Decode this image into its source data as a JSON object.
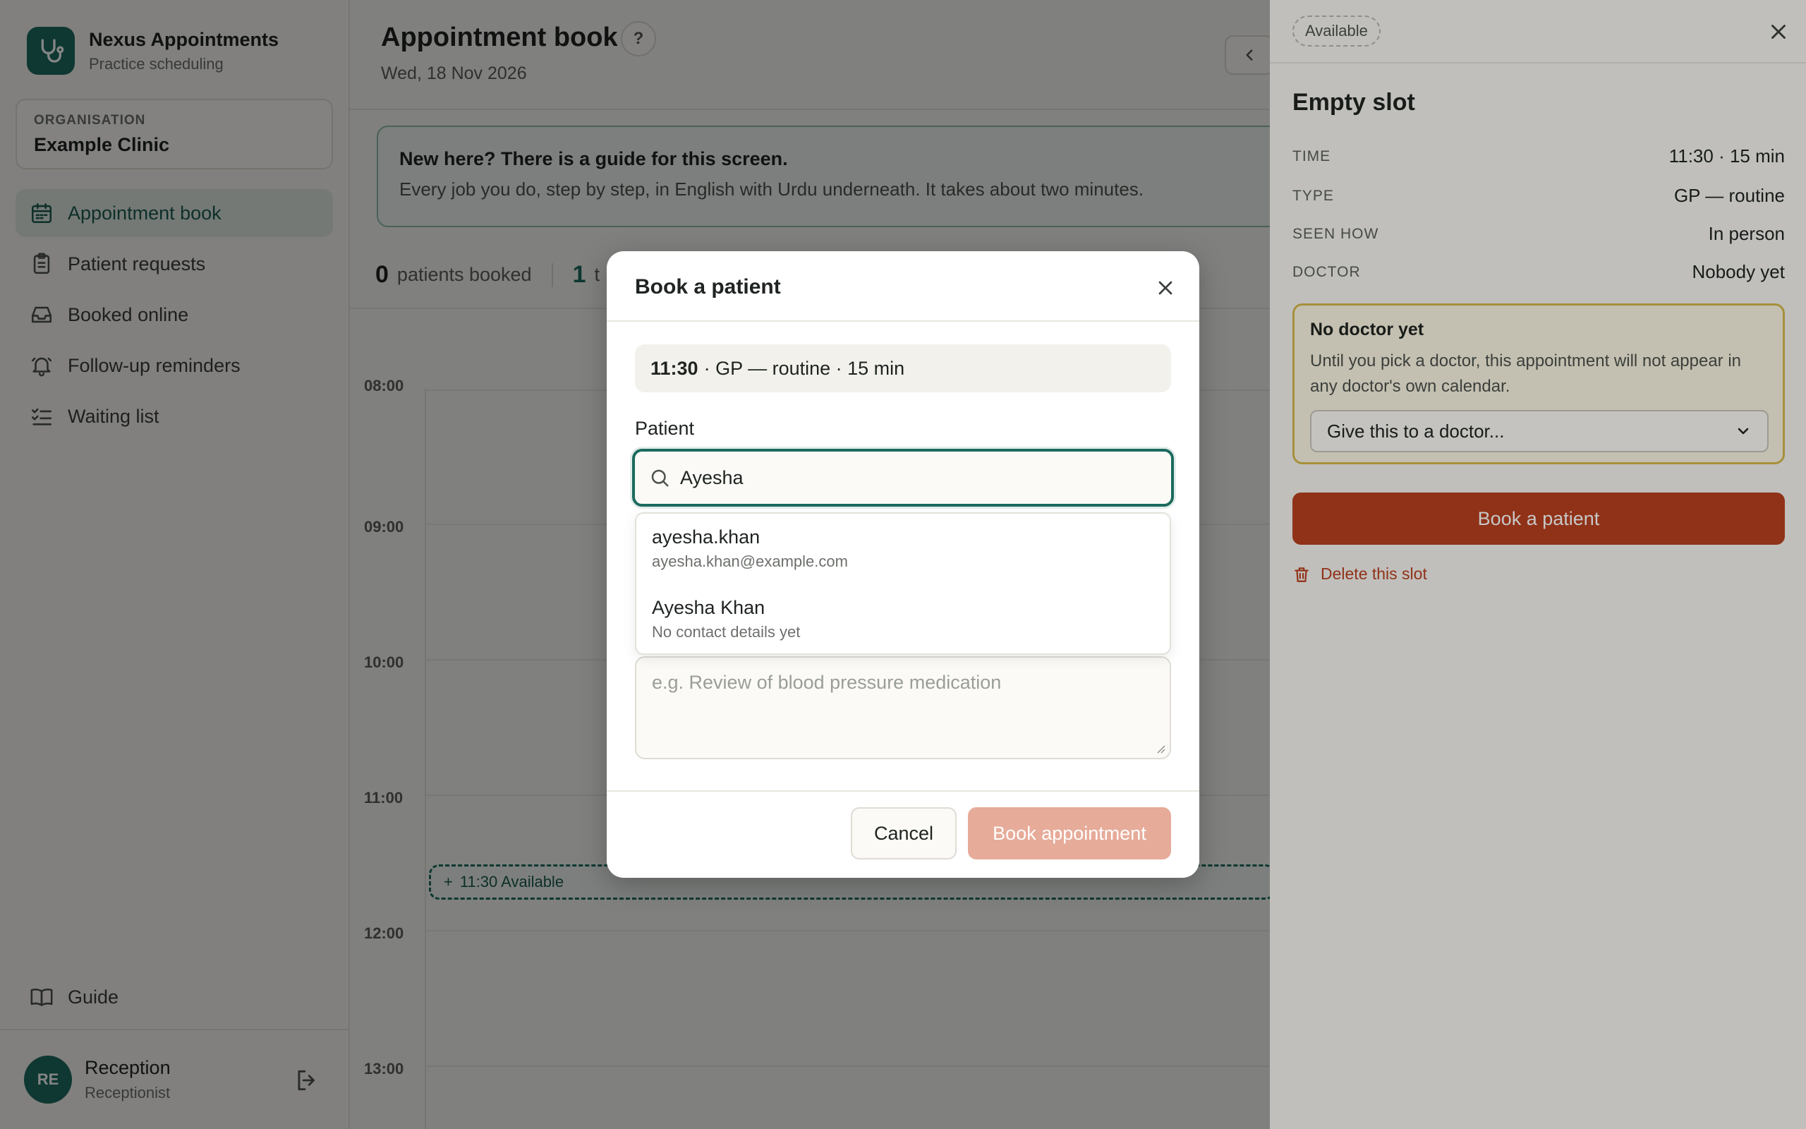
{
  "brand": {
    "name": "Nexus Appointments",
    "subtitle": "Practice scheduling",
    "logo_icon": "stethoscope-icon"
  },
  "organisation": {
    "label": "ORGANISATION",
    "name": "Example Clinic"
  },
  "sidebar": {
    "items": [
      {
        "label": "Appointment book",
        "icon": "calendar-icon",
        "active": true
      },
      {
        "label": "Patient requests",
        "icon": "clipboard-icon",
        "active": false
      },
      {
        "label": "Booked online",
        "icon": "inbox-icon",
        "active": false
      },
      {
        "label": "Follow-up reminders",
        "icon": "bell-icon",
        "active": false
      },
      {
        "label": "Waiting list",
        "icon": "checklist-icon",
        "active": false
      }
    ],
    "guide_label": "Guide"
  },
  "user": {
    "initials": "RE",
    "name": "Reception",
    "role": "Receptionist"
  },
  "header": {
    "title": "Appointment book",
    "help": "?",
    "date": "Wed, 18 Nov 2026"
  },
  "guide_banner": {
    "title": "New here? There is a guide for this screen.",
    "text": "Every job you do, step by step, in English with Urdu underneath. It takes about two minutes."
  },
  "stats": {
    "booked_count": "0",
    "booked_label": "patients booked",
    "second_count": "1",
    "second_label": "t"
  },
  "calendar": {
    "hours": [
      "08:00",
      "09:00",
      "10:00",
      "11:00",
      "12:00",
      "13:00"
    ],
    "slot": {
      "plus": "+",
      "label": "11:30 Available"
    }
  },
  "panel": {
    "badge": "Available",
    "title": "Empty slot",
    "rows": [
      {
        "label": "TIME",
        "value": "11:30 · 15 min"
      },
      {
        "label": "TYPE",
        "value": "GP — routine"
      },
      {
        "label": "SEEN HOW",
        "value": "In person"
      },
      {
        "label": "DOCTOR",
        "value": "Nobody yet"
      }
    ],
    "warning": {
      "title": "No doctor yet",
      "text": "Until you pick a doctor, this appointment will not appear in any doctor's own calendar.",
      "select_value": "Give this to a doctor..."
    },
    "book_label": "Book a patient",
    "delete_label": "Delete this slot",
    "colors": {
      "primary": "#b9401f",
      "warning_border": "#d6b94c"
    }
  },
  "modal": {
    "title": "Book a patient",
    "summary_time": "11:30",
    "summary_rest": "· GP — routine · 15 min",
    "patient_label": "Patient",
    "search_value": "Ayesha",
    "results": [
      {
        "name": "ayesha.khan",
        "detail": "ayesha.khan@example.com"
      },
      {
        "name": "Ayesha Khan",
        "detail": "No contact details yet"
      }
    ],
    "notes_placeholder": "e.g. Review of blood pressure medication",
    "cancel_label": "Cancel",
    "confirm_label": "Book appointment",
    "colors": {
      "accent": "#1c6b5e",
      "confirm_disabled": "#e7ab99"
    }
  }
}
